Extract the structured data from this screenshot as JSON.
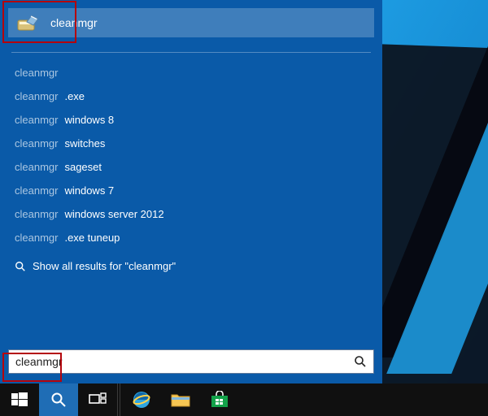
{
  "colors": {
    "panel": "#0a5aa8",
    "accent": "#1fa0e6",
    "highlight": "#b4050d"
  },
  "top_result": {
    "label": "cleanmgr",
    "icon": "disk-cleanup-icon"
  },
  "suggestions": [
    {
      "prefix": "cleanmgr",
      "rest": ""
    },
    {
      "prefix": "cleanmgr",
      "rest": ".exe"
    },
    {
      "prefix": "cleanmgr",
      "rest": " windows 8"
    },
    {
      "prefix": "cleanmgr",
      "rest": " switches"
    },
    {
      "prefix": "cleanmgr",
      "rest": " sageset"
    },
    {
      "prefix": "cleanmgr",
      "rest": " windows 7"
    },
    {
      "prefix": "cleanmgr",
      "rest": " windows server 2012"
    },
    {
      "prefix": "cleanmgr",
      "rest": ".exe tuneup"
    }
  ],
  "show_all": {
    "before": "Show all results for \"",
    "term": "cleanmgr",
    "after": "\""
  },
  "searchbar": {
    "value": "cleanmgr",
    "placeholder": ""
  },
  "taskbar": {
    "items": [
      {
        "name": "start-button",
        "icon": "windows-logo-icon"
      },
      {
        "name": "search-button",
        "icon": "search-icon",
        "active": true
      },
      {
        "name": "task-view-button",
        "icon": "task-view-icon"
      },
      {
        "name": "internet-explorer-button",
        "icon": "ie-icon"
      },
      {
        "name": "file-explorer-button",
        "icon": "folder-icon"
      },
      {
        "name": "store-button",
        "icon": "store-icon"
      }
    ]
  }
}
